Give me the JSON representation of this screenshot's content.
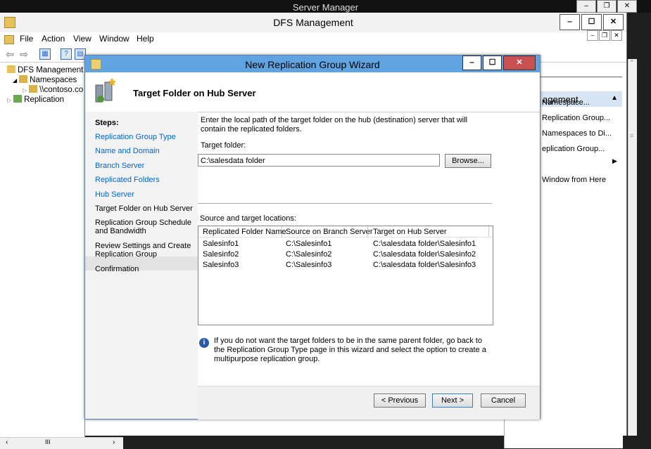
{
  "server_manager": {
    "title": "Server Manager"
  },
  "dfs_window": {
    "title": "DFS Management",
    "menu": [
      "File",
      "Action",
      "View",
      "Window",
      "Help"
    ],
    "tree": [
      {
        "label": "DFS Management"
      },
      {
        "label": "Namespaces"
      },
      {
        "label": "\\\\contoso.co"
      },
      {
        "label": "Replication"
      }
    ],
    "actions": {
      "header": "agement",
      "items": [
        "Namespace...",
        "Replication Group...",
        "Namespaces to Di...",
        "eplication Group...",
        "Window from Here"
      ]
    }
  },
  "wizard": {
    "title": "New Replication Group Wizard",
    "header_title": "Target Folder on Hub Server",
    "steps_label": "Steps:",
    "steps": [
      "Replication Group Type",
      "Name and Domain",
      "Branch Server",
      "Replicated Folders",
      "Hub Server",
      "Target Folder on Hub Server",
      "Replication Group Schedule and Bandwidth",
      "Review Settings and Create Replication Group",
      "Confirmation"
    ],
    "instruction": "Enter the local path of the target folder on the hub (destination) server that will contain the replicated folders.",
    "target_label": "Target folder:",
    "target_value": "C:\\salesdata folder",
    "browse": "Browse...",
    "locations_label": "Source and target locations:",
    "columns": [
      "Replicated Folder Name",
      "Source on Branch Server",
      "Target on Hub Server"
    ],
    "rows": [
      [
        "Salesinfo1",
        "C:\\Salesinfo1",
        "C:\\salesdata folder\\Salesinfo1"
      ],
      [
        "Salesinfo2",
        "C:\\Salesinfo2",
        "C:\\salesdata folder\\Salesinfo2"
      ],
      [
        "Salesinfo3",
        "C:\\Salesinfo3",
        "C:\\salesdata folder\\Salesinfo3"
      ]
    ],
    "info_text": "If you do not want the target folders to be in the same parent folder, go back to the Replication Group Type page in this wizard and select the option to create a multipurpose replication group.",
    "buttons": {
      "previous": "< Previous",
      "next": "Next >",
      "cancel": "Cancel"
    }
  },
  "colors": {
    "wizard_titlebar": "#5fa3e0",
    "close_button": "#c75050",
    "link": "#0066cc"
  }
}
